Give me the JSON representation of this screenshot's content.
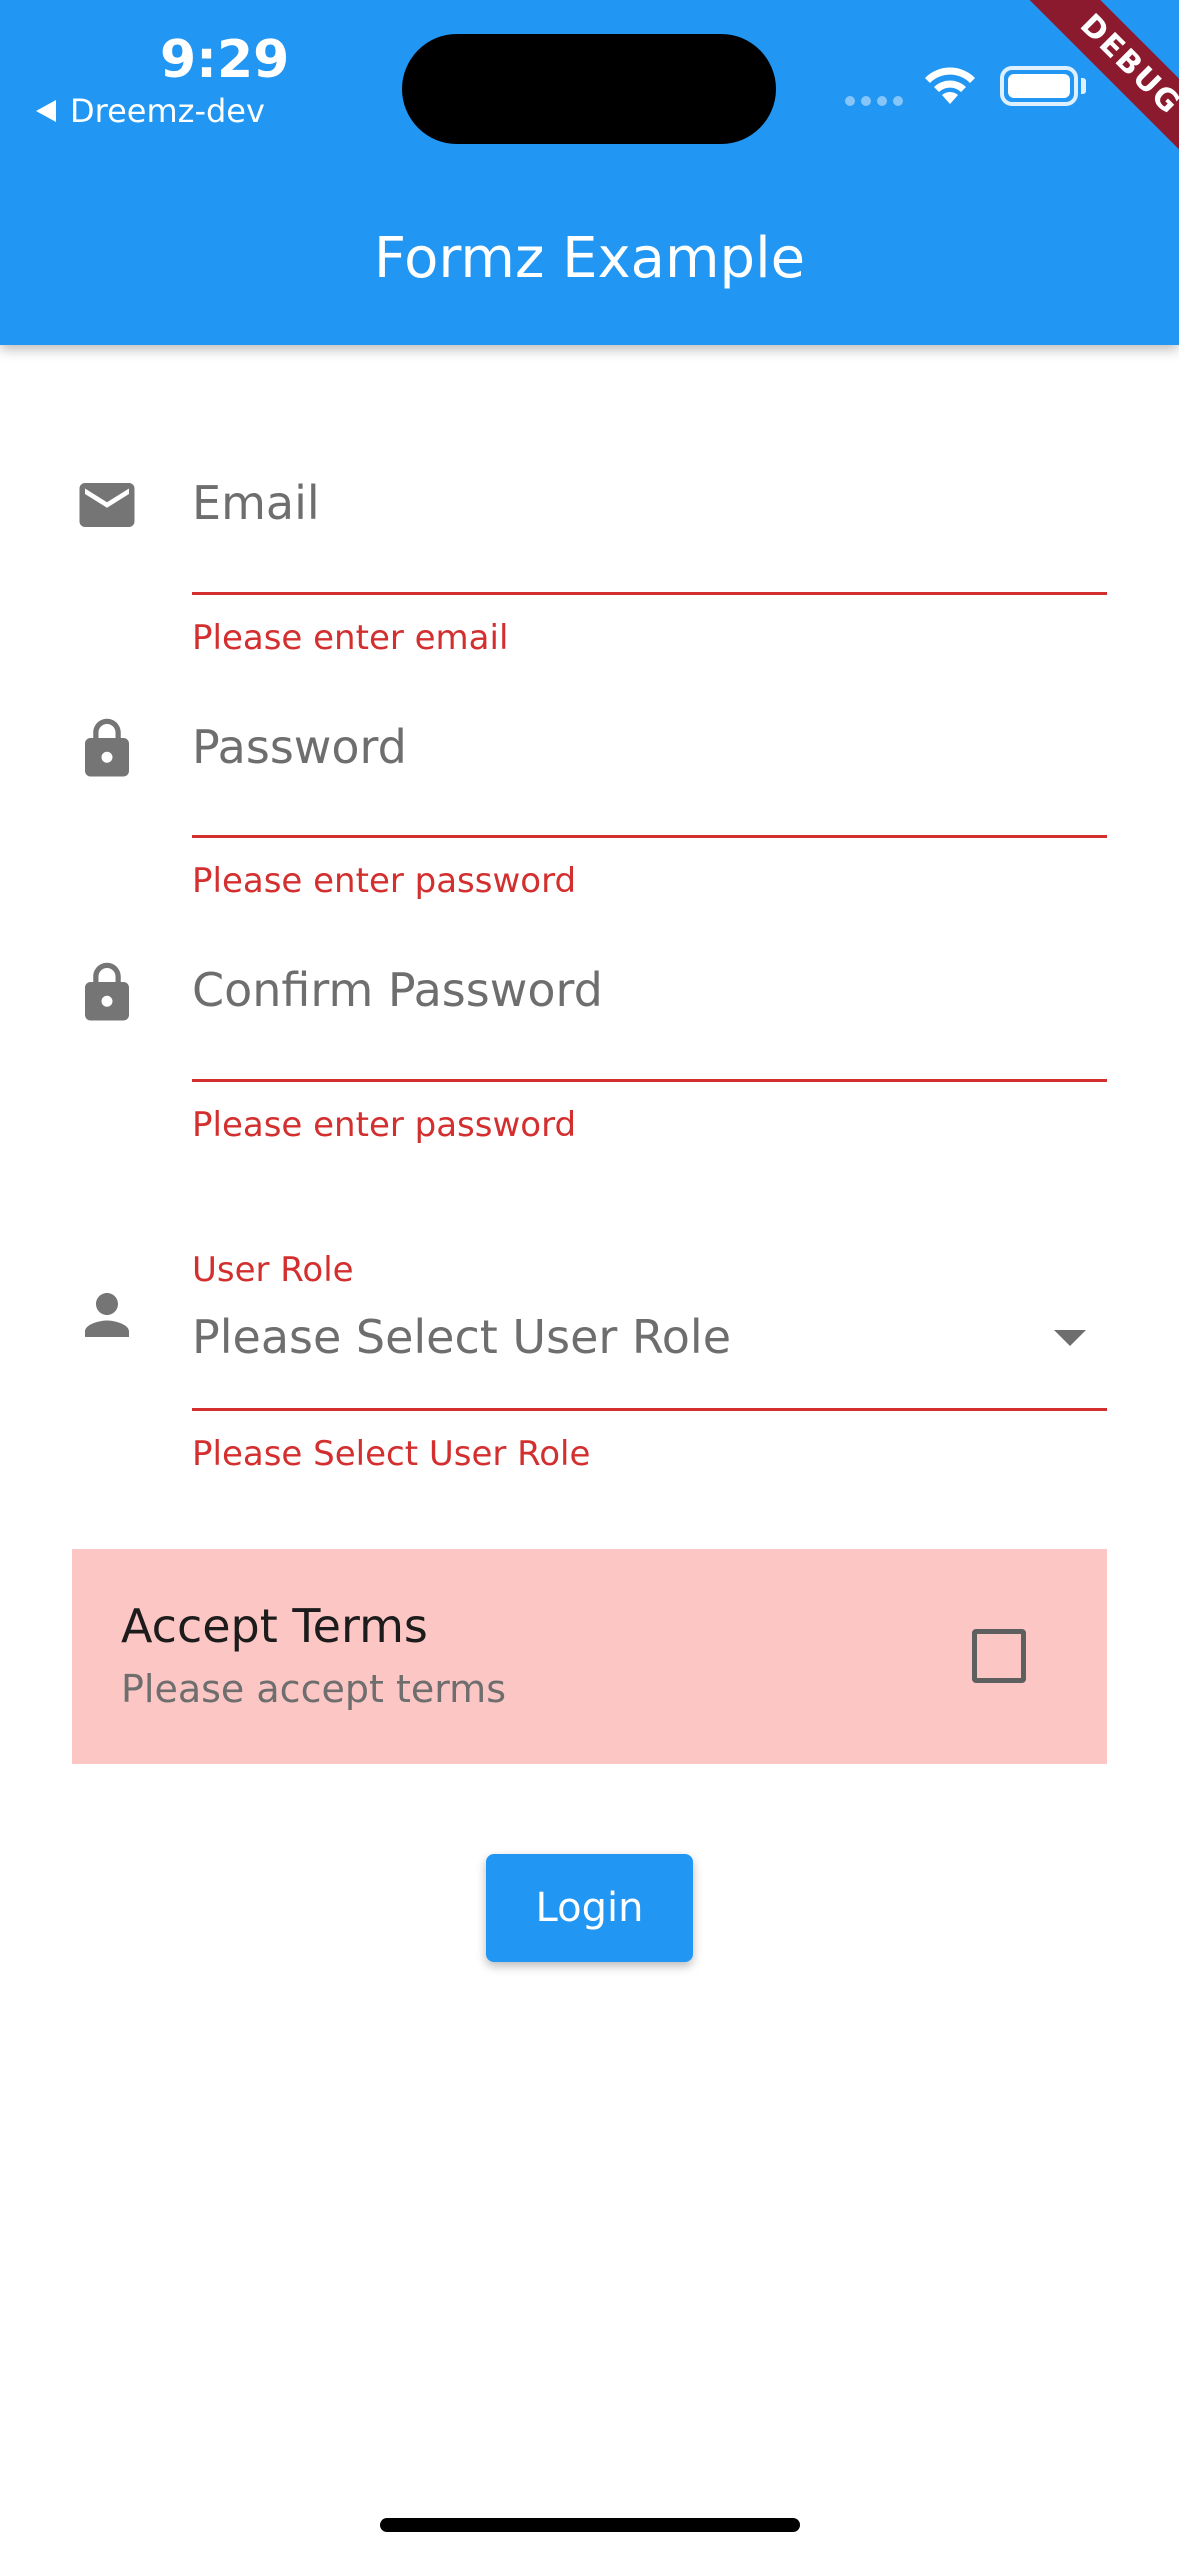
{
  "status_bar": {
    "time": "9:29",
    "back_label": "Dreemz-dev"
  },
  "debug_banner": "DEBUG",
  "app_bar": {
    "title": "Formz Example",
    "color": "#2196f3"
  },
  "form": {
    "email": {
      "icon": "mail-icon",
      "label": "Email",
      "error": "Please enter email"
    },
    "password": {
      "icon": "lock-icon",
      "label": "Password",
      "error": "Please enter password"
    },
    "confirm_password": {
      "icon": "lock-icon",
      "label": "Confirm Password",
      "error": "Please enter password"
    },
    "user_role": {
      "icon": "person-icon",
      "label": "User Role",
      "value": "Please Select User Role",
      "error": "Please Select User Role"
    },
    "terms": {
      "title": "Accept Terms",
      "subtitle": "Please accept terms",
      "checked": false,
      "background": "#fcc6c4"
    },
    "login_label": "Login"
  },
  "colors": {
    "error": "#d32f2f",
    "primary": "#2196f3"
  }
}
